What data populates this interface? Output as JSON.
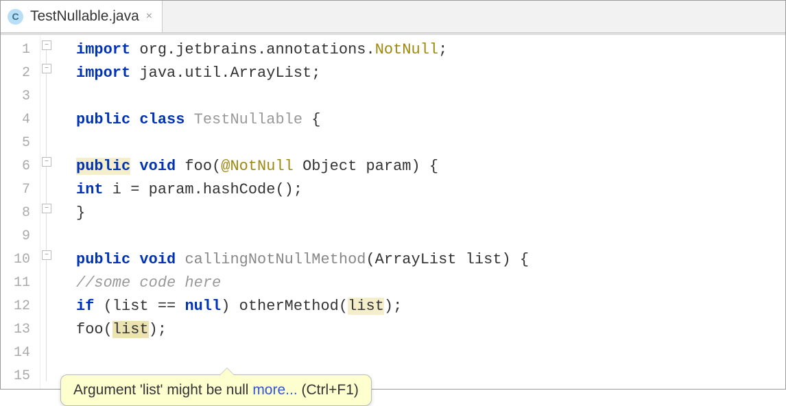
{
  "tab": {
    "icon_letter": "C",
    "filename": "TestNullable.java",
    "close_glyph": "×"
  },
  "line_numbers": [
    "1",
    "2",
    "3",
    "4",
    "5",
    "6",
    "7",
    "8",
    "9",
    "10",
    "11",
    "12",
    "13",
    "14",
    "15"
  ],
  "code": {
    "l1": {
      "kw_import": "import",
      "pkg1": " org.jetbrains.annotations.",
      "cls": "NotNull",
      "end": ";"
    },
    "l2": {
      "kw_import": "import",
      "pkg2": " java.util.ArrayList;"
    },
    "l4": {
      "kw_public": "public ",
      "kw_class": "class ",
      "name": "TestNullable",
      "brace": " {"
    },
    "l6": {
      "kw_public": "public",
      "sp": " ",
      "kw_void": "void",
      "fn": " foo(",
      "ann": "@NotNull",
      "rest": " Object param) {"
    },
    "l7": {
      "kw_int": "int",
      "rest": " i = param.hashCode();"
    },
    "l8": {
      "brace": "}"
    },
    "l10": {
      "kw_public": "public ",
      "kw_void": "void ",
      "name": "callingNotNullMethod",
      "rest": "(ArrayList list) {"
    },
    "l11": {
      "comment": "//some code here"
    },
    "l12": {
      "kw_if": "if",
      "p1": " (list == ",
      "kw_null": "null",
      "p2": ") otherMethod(",
      "hl": "list",
      "p3": ");"
    },
    "l13": {
      "pre": "foo(",
      "hl": "list",
      "post": ");"
    }
  },
  "tooltip": {
    "text": "Argument 'list' might be null ",
    "link": "more...",
    "shortcut": " (Ctrl+F1)"
  }
}
